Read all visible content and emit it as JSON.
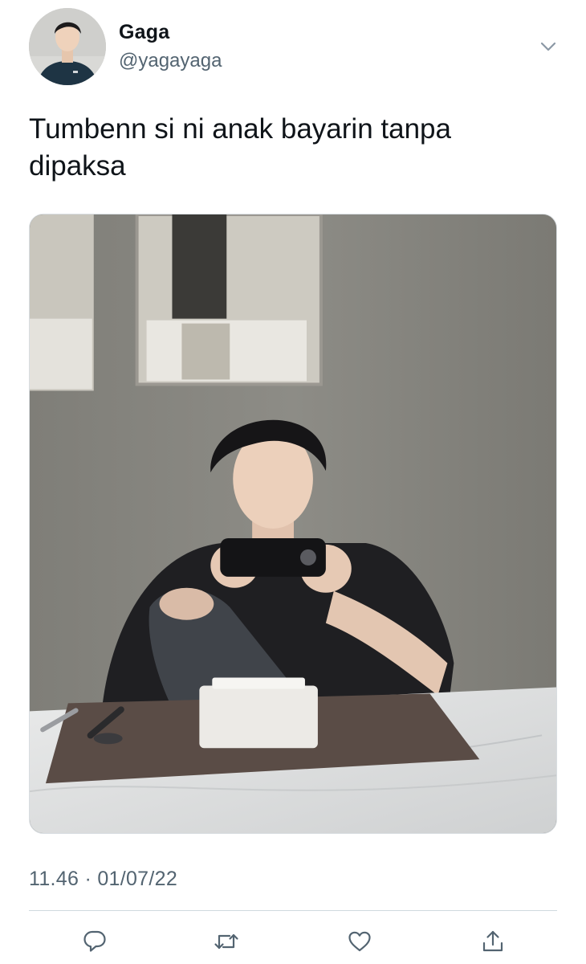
{
  "user": {
    "display_name": "Gaga",
    "handle": "@yagayaga",
    "avatar": "profile-photo"
  },
  "tweet": {
    "text": "Tumbenn si ni anak bayarin tanpa dipaksa",
    "timestamp": "11.46 · 01/07/22",
    "media": "photo-young-man-with-phone-at-dining-table"
  },
  "header": {
    "menu_icon": "chevron-down-icon"
  },
  "actions": [
    {
      "name": "reply",
      "icon": "reply-icon"
    },
    {
      "name": "retweet",
      "icon": "retweet-icon"
    },
    {
      "name": "like",
      "icon": "heart-icon"
    },
    {
      "name": "share",
      "icon": "share-icon"
    }
  ],
  "colors": {
    "text_primary": "#0f1419",
    "text_secondary": "#536471",
    "divider": "#cfd9de"
  }
}
